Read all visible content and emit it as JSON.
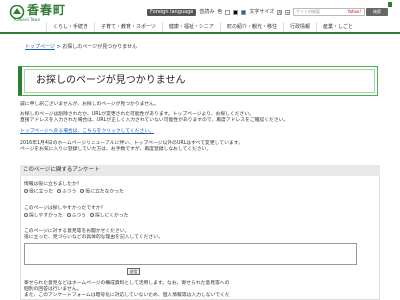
{
  "header": {
    "logo_text": "香春町",
    "logo_sub": "Kawara Town",
    "foreign_language": "Foreign language",
    "voice_label": "音読み",
    "color_label": "色",
    "text_size_label": "文字サイズ",
    "text_size_a": "A",
    "text_size_plus": "+",
    "search_placeholder": "サイト内検索",
    "search_brand": "Yahoo!",
    "search_button": "検索"
  },
  "nav": {
    "items": [
      "くらし・手続き",
      "子育て・教育・スポーツ",
      "健康・福祉・シニア",
      "町の紹介・観光・移住",
      "行政情報",
      "産業・しごと"
    ]
  },
  "breadcrumb": {
    "home": "トップページ",
    "sep": ">",
    "current": "お探しのページが見つかりません"
  },
  "main": {
    "title": "お探しのページが見つかりません",
    "p1": "誠に申し訳ございませんが、お探しのページが見つかりません。",
    "p2_l1": "お探しのページは削除されたか、URLが変更された可能性があります。トップページより、お探しください。",
    "p2_l2": "直接アドレスを入力された場合は、URLが正しく入力されていない可能性がありますので、再度アドレスをご確認ください。",
    "p3_link": "トップページへ戻る場合は、こちらをクリックしてください。",
    "p4_l1": "2016年1月4日のホームページリニューアルに伴い、トップページ以外のURLはすべて変更しています。",
    "p4_l2": "ページをお気に入りに登録していた方は、お手数ですが、再度登録しなおしてください。"
  },
  "survey": {
    "heading": "このページに関するアンケート",
    "q1": "情報は役に立ちましたか？",
    "q1_opts": [
      "役に立った",
      "ふつう",
      "役に立たなかった"
    ],
    "q2": "このページは探しやすかったですか？",
    "q2_opts": [
      "探しやすかった",
      "ふつう",
      "探しにくかった"
    ],
    "q3_l1": "このページに対する意見等をお聞かせください。",
    "q3_l2": "役に立った、見づらいなどの具体的な理由を記入してください。",
    "submit": "送信",
    "note_l1": "寄せられた意見などはホームページの構成資料として活用します。なお、寄せられた意見等への",
    "note_l2": "個別の回答は行いません。",
    "note_l3": "また、このアンケートフォームは暗号化に対応していないため、個人情報等は入力しないでくだ"
  }
}
